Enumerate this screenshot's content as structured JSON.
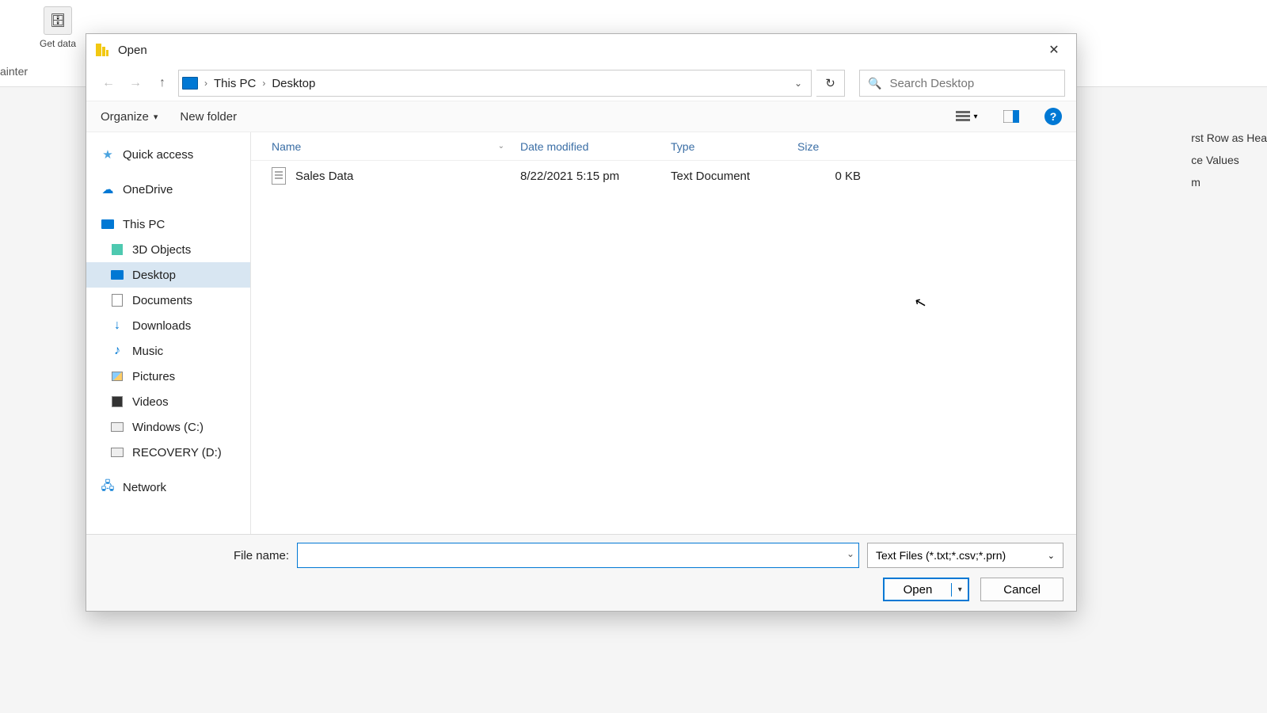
{
  "ribbon": {
    "get_data_label": "Get data",
    "painter_label": "ainter"
  },
  "dialog": {
    "title": "Open",
    "breadcrumbs": [
      "This PC",
      "Desktop"
    ],
    "search_placeholder": "Search Desktop",
    "toolbar": {
      "organize": "Organize",
      "new_folder": "New folder"
    },
    "columns": {
      "name": "Name",
      "date": "Date modified",
      "type": "Type",
      "size": "Size"
    },
    "sidebar": {
      "quick_access": "Quick access",
      "onedrive": "OneDrive",
      "this_pc": "This PC",
      "objects3d": "3D Objects",
      "desktop": "Desktop",
      "documents": "Documents",
      "downloads": "Downloads",
      "music": "Music",
      "pictures": "Pictures",
      "videos": "Videos",
      "drive_c": "Windows (C:)",
      "drive_d": "RECOVERY (D:)",
      "network": "Network"
    },
    "files": [
      {
        "name": "Sales Data",
        "date": "8/22/2021 5:15 pm",
        "type": "Text Document",
        "size": "0 KB"
      }
    ],
    "footer": {
      "filename_label": "File name:",
      "filename_value": "",
      "filter": "Text Files (*.txt;*.csv;*.prn)",
      "open": "Open",
      "cancel": "Cancel"
    }
  },
  "behind": {
    "line1": "rst Row as Hea",
    "line2": "ce Values",
    "line3": "m"
  }
}
